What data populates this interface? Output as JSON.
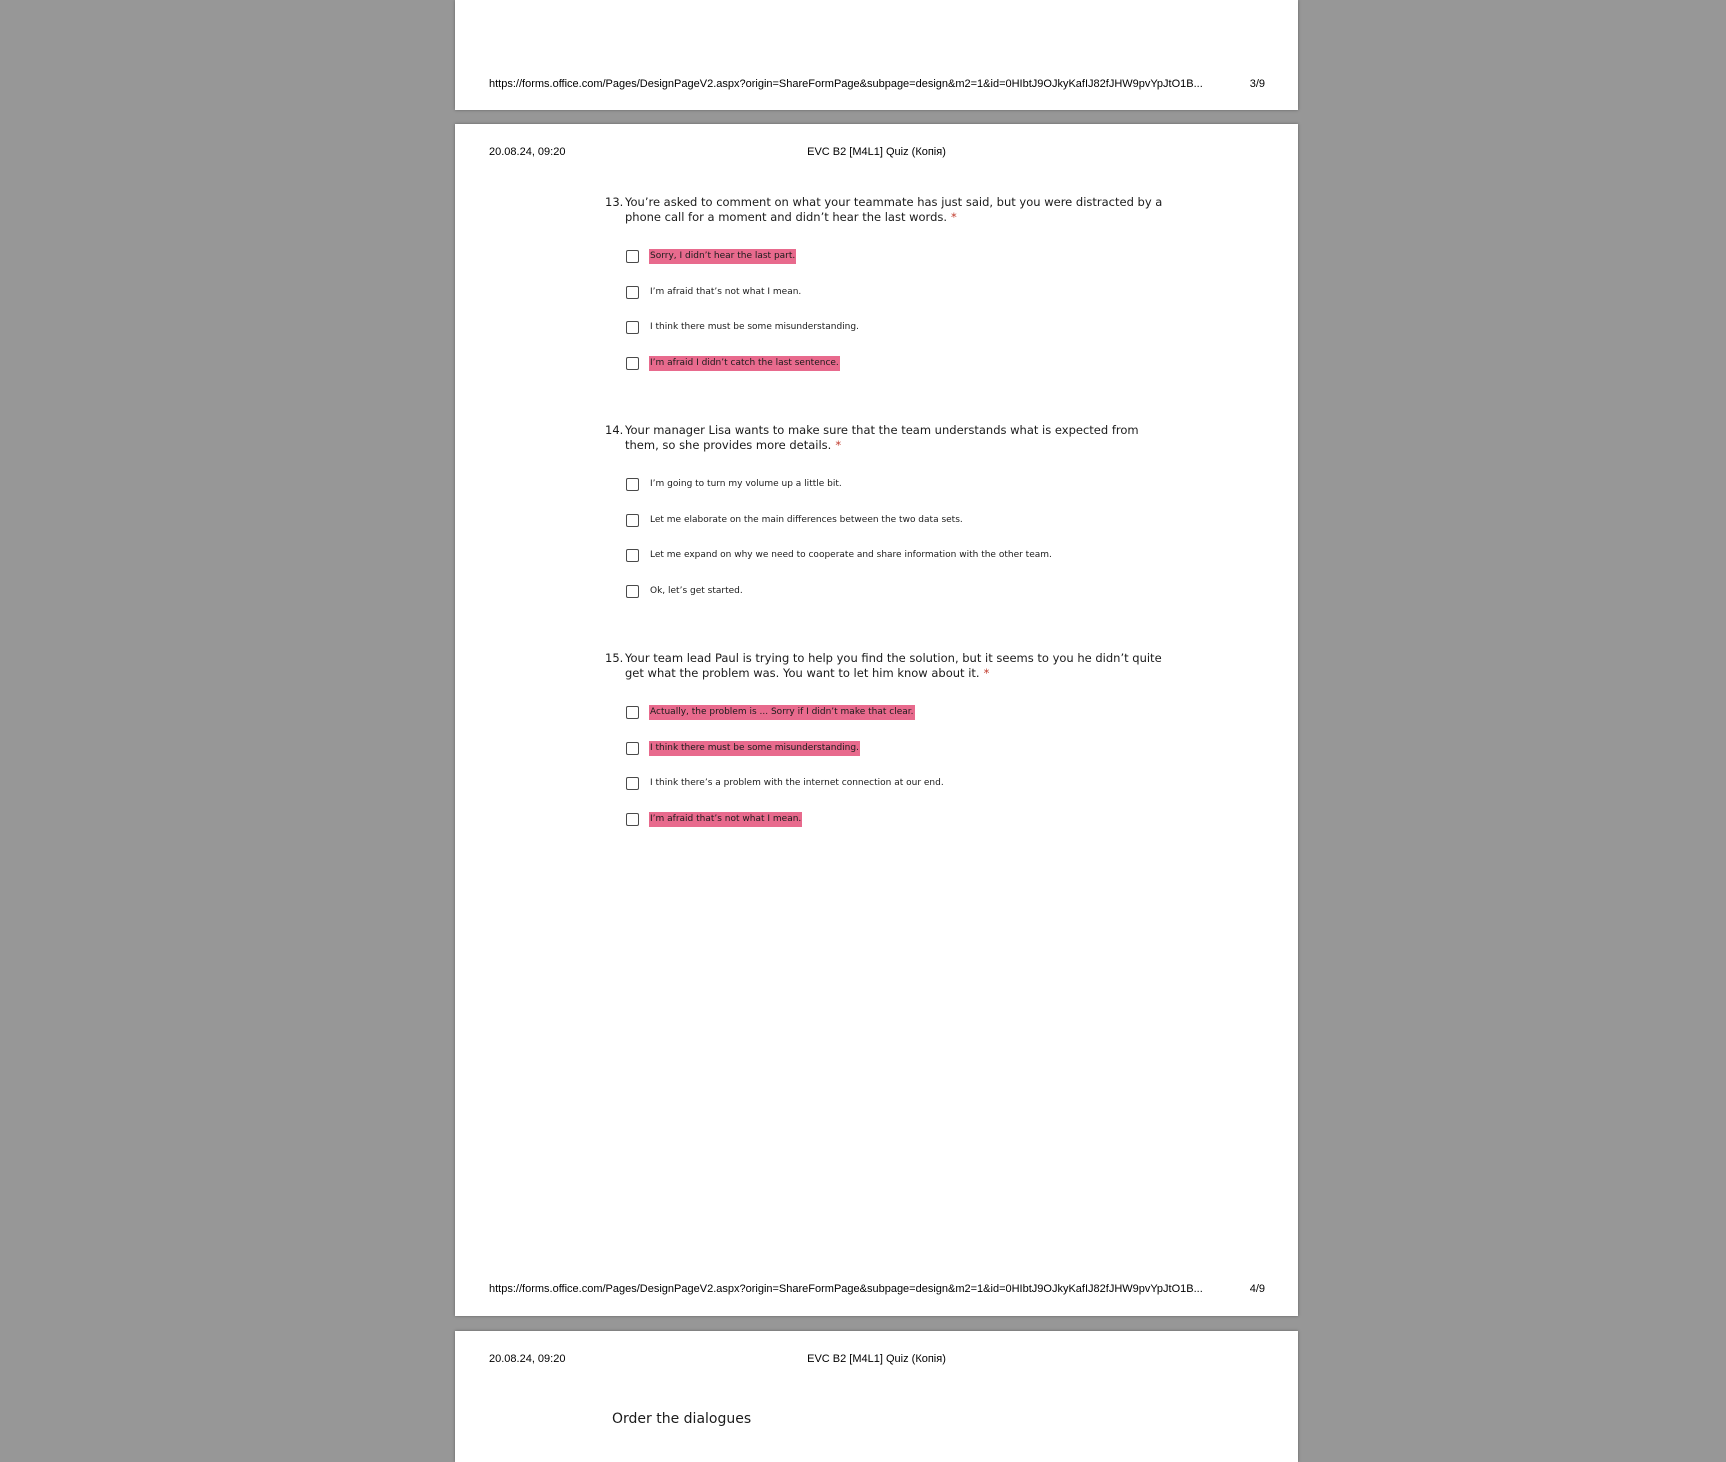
{
  "pages": {
    "prev": {
      "footer_url": "https://forms.office.com/Pages/DesignPageV2.aspx?origin=ShareFormPage&subpage=design&m2=1&id=0HIbtJ9OJkyKafIJ82fJHW9pvYpJtO1B...",
      "footer_page": "3/9"
    },
    "main": {
      "header_date": "20.08.24, 09:20",
      "header_title": "EVC B2 [M4L1] Quiz (Копія)",
      "footer_url": "https://forms.office.com/Pages/DesignPageV2.aspx?origin=ShareFormPage&subpage=design&m2=1&id=0HIbtJ9OJkyKafIJ82fJHW9pvYpJtO1B...",
      "footer_page": "4/9"
    },
    "next": {
      "header_date": "20.08.24, 09:20",
      "header_title": "EVC B2 [M4L1] Quiz (Копія)",
      "section_title": "Order the dialogues"
    }
  },
  "questions": [
    {
      "number": "13.",
      "text": "You’re asked to comment on what your teammate has just said, but you were distracted by a phone call for a moment and didn’t hear the last words.",
      "required": "*",
      "options": [
        {
          "label": "Sorry, I didn’t hear the last part.",
          "highlighted": true
        },
        {
          "label": "I’m afraid that’s not what I mean.",
          "highlighted": false
        },
        {
          "label": "I think there must be some misunderstanding.",
          "highlighted": false
        },
        {
          "label": "I’m afraid I didn’t catch the last sentence.",
          "highlighted": true
        }
      ]
    },
    {
      "number": "14.",
      "text": "Your manager Lisa wants to make sure that the team understands what is expected from them, so she provides more details.",
      "required": "*",
      "options": [
        {
          "label": "I’m going to turn my volume up a little bit.",
          "highlighted": false
        },
        {
          "label": "Let me elaborate on the main differences between the two data sets.",
          "highlighted": false
        },
        {
          "label": "Let me expand on why we need to cooperate and share information with the other team.",
          "highlighted": false
        },
        {
          "label": "Ok, let’s get started.",
          "highlighted": false
        }
      ]
    },
    {
      "number": "15.",
      "text": "Your team lead Paul is trying to help you find the solution, but it seems to you he didn’t quite get what the problem was. You want to let him know about it.",
      "required": "*",
      "options": [
        {
          "label": "Actually, the problem is ... Sorry if I didn’t make that clear.",
          "highlighted": true
        },
        {
          "label": "I think there must be some misunderstanding.",
          "highlighted": true
        },
        {
          "label": "I think there’s a problem with the internet connection at our end.",
          "highlighted": false
        },
        {
          "label": "I’m afraid that’s not what I mean.",
          "highlighted": true
        }
      ]
    }
  ],
  "colors": {
    "highlight": "#e86a8d",
    "required_star": "#c0392b",
    "background": "#979797"
  }
}
